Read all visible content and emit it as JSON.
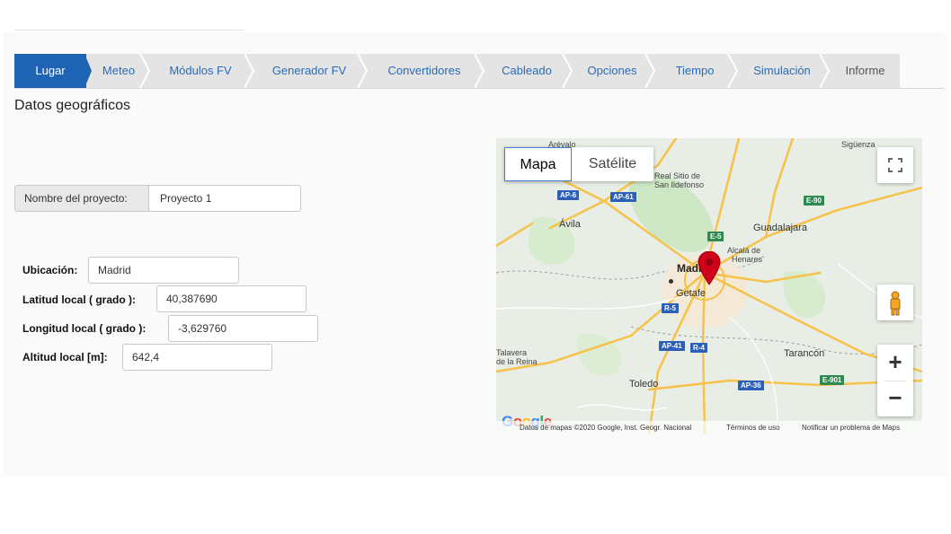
{
  "tabs": [
    {
      "label": "Lugar",
      "active": true
    },
    {
      "label": "Meteo"
    },
    {
      "label": "Módulos FV"
    },
    {
      "label": "Generador FV"
    },
    {
      "label": "Convertidores"
    },
    {
      "label": "Cableado"
    },
    {
      "label": "Opciones"
    },
    {
      "label": "Tiempo"
    },
    {
      "label": "Simulación"
    },
    {
      "label": "Informe"
    }
  ],
  "section_title": "Datos geográficos",
  "project": {
    "label": "Nombre del proyecto:",
    "value": "Proyecto 1"
  },
  "fields": {
    "location": {
      "label": "Ubicación:",
      "value": "Madrid"
    },
    "latitude": {
      "label": "Latitud local ( grado ):",
      "value": "40,387690"
    },
    "longitude": {
      "label": "Longitud local ( grado ):",
      "value": "-3,629760"
    },
    "altitude": {
      "label": "Altitud local [m]:",
      "value": "642,4"
    }
  },
  "map": {
    "type_map": "Mapa",
    "type_satellite": "Satélite",
    "zoom_in": "+",
    "zoom_out": "−",
    "places": {
      "arevalo": "Arévalo",
      "siguenza": "Sigüenza",
      "san_ildefonso_1": "Real Sitio de",
      "san_ildefonso_2": "San Ildefonso",
      "avila": "Ávila",
      "guadalajara": "Guadalajara",
      "alcala_1": "Alcalá de",
      "alcala_2": "Henares",
      "madrid": "Madrid",
      "getafe": "Getafe",
      "talavera_1": "Talavera",
      "talavera_2": "de la Reina",
      "toledo": "Toledo",
      "tarancon": "Tarancón"
    },
    "roads": {
      "ap6": "AP-6",
      "ap61": "AP-61",
      "e90": "E-90",
      "e5": "E-5",
      "r5": "R-5",
      "ap41": "AP-41",
      "r4": "R-4",
      "ap36": "AP-36",
      "e901": "E-901"
    },
    "google": "Google",
    "footer": {
      "data": "Datos de mapas ©2020 Google, Inst. Geogr. Nacional",
      "terms": "Términos de uso",
      "report": "Notificar un problema de Maps"
    },
    "colors": {
      "highway": "#f6c24a",
      "road_white": "#ffffff",
      "green": "#cde6c4",
      "pin": "#d0021b"
    }
  },
  "colors": {
    "active_tab": "#1f64b4",
    "tab_bar": "#e4e4e4",
    "link": "#2a6bb6"
  }
}
